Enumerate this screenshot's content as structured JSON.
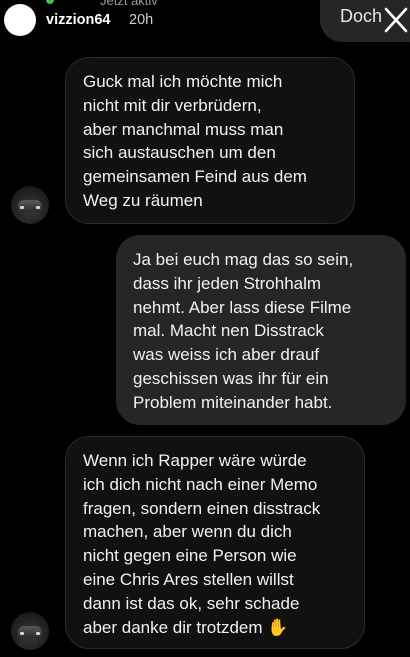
{
  "header": {
    "active_status": "Jetzt aktiv",
    "username": "vizzion64",
    "time_ago": "20h",
    "prev_message_snippet": "Doch",
    "close_icon": "close-icon",
    "active_dot_color": "#3ec64a"
  },
  "messages": [
    {
      "direction": "incoming",
      "text": "Guck mal ich möchte mich\nnicht mit dir verbrüdern,\naber manchmal muss man\nsich austauschen um den\ngemeinsamen Feind aus dem\nWeg zu räumen"
    },
    {
      "direction": "outgoing",
      "text": "Ja bei euch mag das so sein,\ndass ihr jeden Strohhalm\nnehmt. Aber lass diese Filme\nmal. Macht nen Disstrack\nwas weiss ich aber drauf\ngeschissen was ihr für ein\nProblem miteinander habt."
    },
    {
      "direction": "incoming",
      "text": "Wenn ich Rapper wäre würde\nich dich nicht nach einer Memo\nfragen, sondern einen disstrack\nmachen, aber wenn du dich\nnicht gegen eine Person wie\neine Chris Ares stellen willst\ndann ist das ok, sehr schade\naber danke dir trotzdem ✋"
    }
  ],
  "colors": {
    "background": "#000000",
    "incoming_bubble": "#111111",
    "outgoing_bubble": "#262626",
    "text": "#f2f2f2"
  }
}
